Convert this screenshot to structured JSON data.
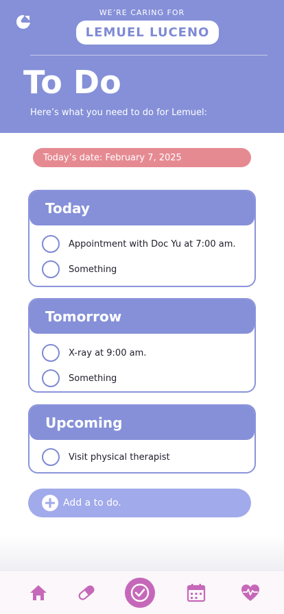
{
  "header": {
    "caring_label": "WE’RE CARING FOR",
    "patient_name": "LEMUEL LUCENO",
    "title": "To Do",
    "subtitle": "Here’s what you need to do for Lemuel:"
  },
  "date_text": "Today’s date: February 7, 2025",
  "sections": [
    {
      "title": "Today",
      "items": [
        "Appointment with Doc Yu at 7:00 am.",
        "Something"
      ]
    },
    {
      "title": "Tomorrow",
      "items": [
        "X-ray at 9:00 am.",
        "Something"
      ]
    },
    {
      "title": "Upcoming",
      "items": [
        "Visit physical therapist"
      ]
    }
  ],
  "add_todo_label": "Add a to do.",
  "nav": {
    "items": [
      "home-icon",
      "pill-icon",
      "check-circle-icon",
      "calendar-icon",
      "heart-pulse-icon"
    ],
    "active": "check-circle-icon"
  },
  "colors": {
    "primary": "#8590d8",
    "date_pill": "#e68a92",
    "nav_accent": "#c668b9",
    "add_button": "#a1aaea"
  }
}
